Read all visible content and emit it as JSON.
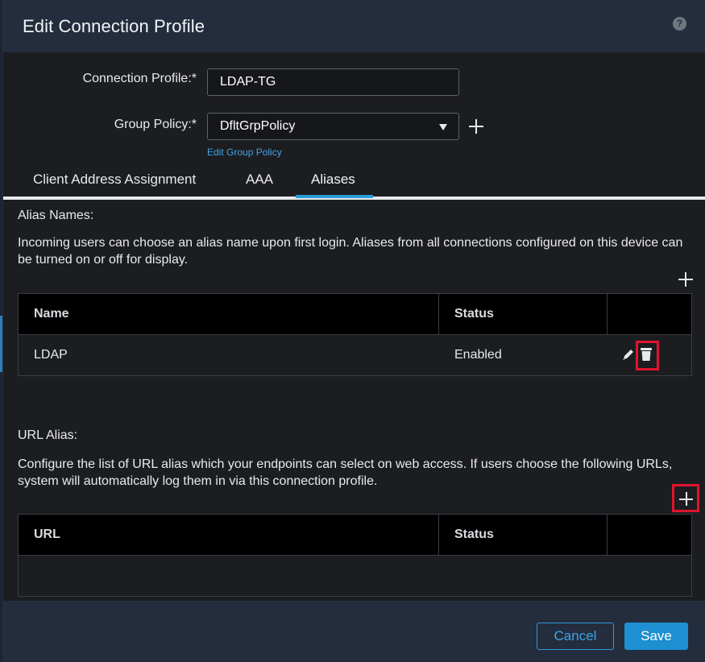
{
  "dialog": {
    "title": "Edit Connection Profile",
    "help_icon": "question-mark-icon"
  },
  "form": {
    "connection_profile": {
      "label": "Connection Profile:*",
      "value": "LDAP-TG"
    },
    "group_policy": {
      "label": "Group Policy:*",
      "value": "DfltGrpPolicy",
      "edit_link": "Edit Group Policy"
    }
  },
  "tabs": [
    {
      "label": "Client Address Assignment",
      "active": false
    },
    {
      "label": "AAA",
      "active": false
    },
    {
      "label": "Aliases",
      "active": true
    }
  ],
  "alias_names": {
    "title": "Alias Names:",
    "description": "Incoming users can choose an alias name upon first login. Aliases from all connections configured on this device can be turned on or off for display.",
    "columns": [
      "Name",
      "Status",
      ""
    ],
    "rows": [
      {
        "name": "LDAP",
        "status": "Enabled"
      }
    ]
  },
  "url_alias": {
    "title": "URL Alias:",
    "description": "Configure the list of URL alias which your endpoints can select on web access. If users choose the following URLs, system will automatically log them in via this connection profile.",
    "columns": [
      "URL",
      "Status",
      ""
    ],
    "rows": []
  },
  "footer": {
    "cancel_label": "Cancel",
    "save_label": "Save"
  },
  "colors": {
    "header_bg": "#232d3d",
    "accent": "#2a9bd9",
    "highlight": "#e0142f"
  }
}
